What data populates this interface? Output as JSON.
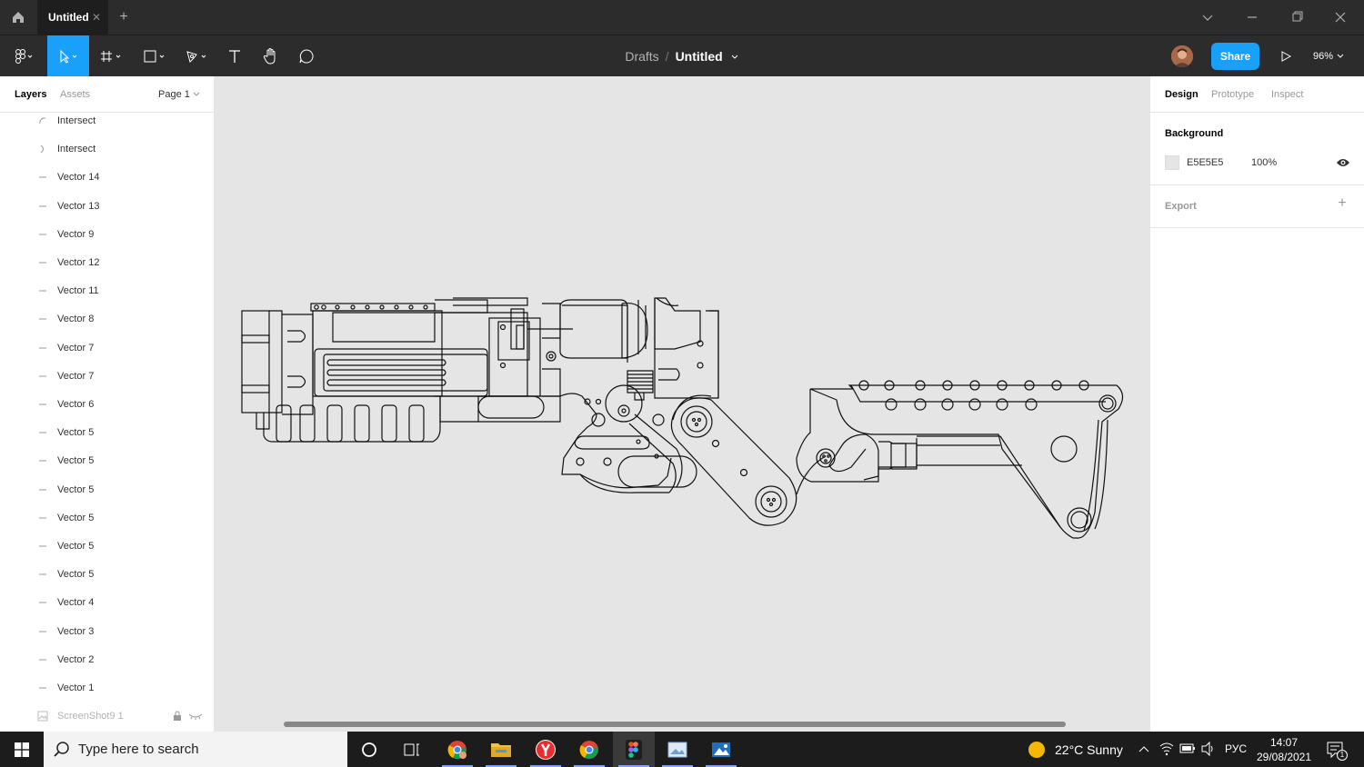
{
  "titlebar": {
    "tab_title": "Untitled",
    "new_tab_label": "+"
  },
  "toolbar": {
    "breadcrumb_drafts": "Drafts",
    "breadcrumb_separator": "/",
    "file_name": "Untitled",
    "share_label": "Share",
    "zoom_value": "96%"
  },
  "left_panel": {
    "tab_layers": "Layers",
    "tab_assets": "Assets",
    "page_label": "Page 1",
    "layers": [
      {
        "name": "Intersect",
        "icon": "intersect-arc-icon"
      },
      {
        "name": "Intersect",
        "icon": "intersect-curve-icon"
      },
      {
        "name": "Vector 14",
        "icon": "vector-icon"
      },
      {
        "name": "Vector 13",
        "icon": "vector-icon"
      },
      {
        "name": "Vector 9",
        "icon": "vector-icon"
      },
      {
        "name": "Vector 12",
        "icon": "vector-icon"
      },
      {
        "name": "Vector 11",
        "icon": "vector-icon"
      },
      {
        "name": "Vector 8",
        "icon": "vector-icon"
      },
      {
        "name": "Vector 7",
        "icon": "vector-icon"
      },
      {
        "name": "Vector 7",
        "icon": "vector-icon"
      },
      {
        "name": "Vector 6",
        "icon": "vector-icon"
      },
      {
        "name": "Vector 5",
        "icon": "vector-icon"
      },
      {
        "name": "Vector 5",
        "icon": "vector-icon"
      },
      {
        "name": "Vector 5",
        "icon": "vector-icon"
      },
      {
        "name": "Vector 5",
        "icon": "vector-icon"
      },
      {
        "name": "Vector 5",
        "icon": "vector-icon"
      },
      {
        "name": "Vector 5",
        "icon": "vector-icon"
      },
      {
        "name": "Vector 4",
        "icon": "vector-icon"
      },
      {
        "name": "Vector 3",
        "icon": "vector-icon"
      },
      {
        "name": "Vector 2",
        "icon": "vector-icon"
      },
      {
        "name": "Vector 1",
        "icon": "vector-icon"
      },
      {
        "name": "ScreenShot9 1",
        "icon": "image-icon",
        "locked": true,
        "hidden": true
      }
    ]
  },
  "right_panel": {
    "tab_design": "Design",
    "tab_prototype": "Prototype",
    "tab_inspect": "Inspect",
    "background_title": "Background",
    "background_hex": "E5E5E5",
    "background_opacity": "100%",
    "export_title": "Export"
  },
  "canvas": {
    "background_color": "#e5e5e5",
    "help_label": "?"
  },
  "taskbar": {
    "search_placeholder": "Type here to search",
    "weather": "22°C  Sunny",
    "language": "РУС",
    "time": "14:07",
    "date": "29/08/2021",
    "notification_count": "1"
  },
  "colors": {
    "accent": "#18a0fb",
    "toolbar_bg": "#2c2c2c",
    "canvas_bg": "#e5e5e5"
  }
}
